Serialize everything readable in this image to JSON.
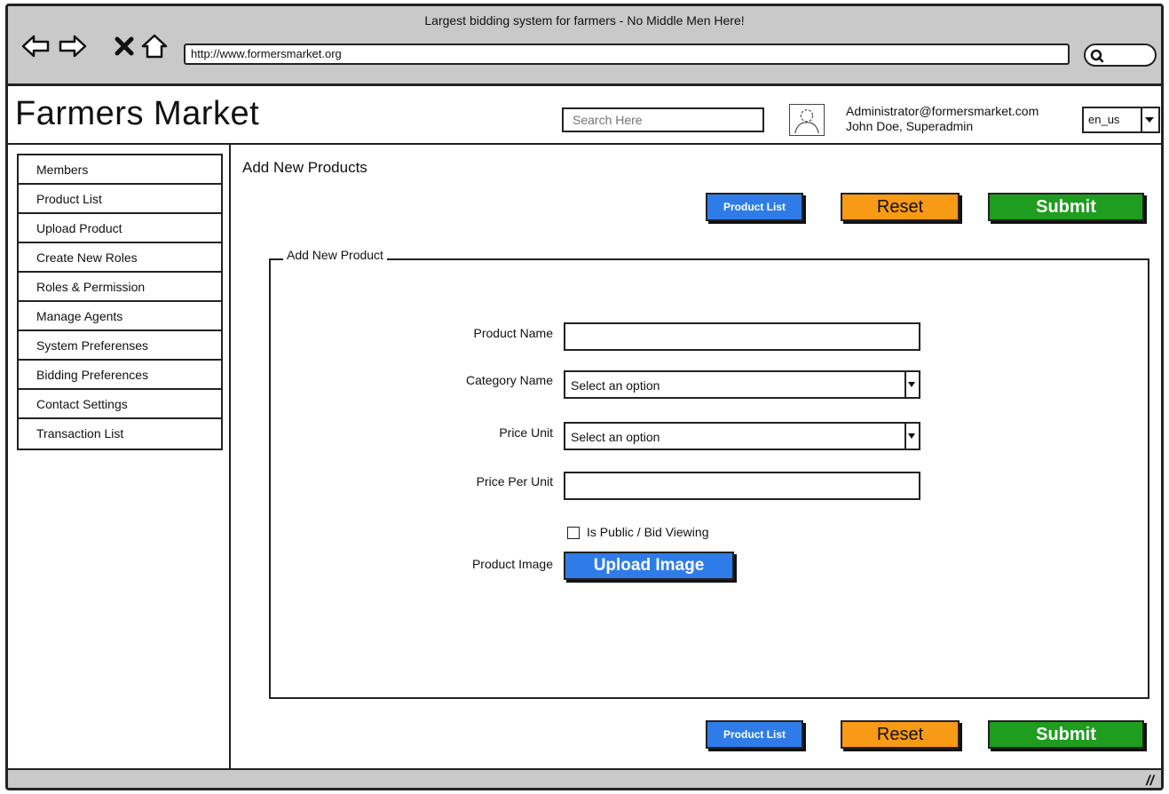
{
  "window": {
    "title": "Largest bidding system for farmers - No Middle Men Here!",
    "url": "http://www.formersmarket.org"
  },
  "header": {
    "app_title": "Farmers Market",
    "search_placeholder": "Search Here",
    "user_email": "Administrator@formersmarket.com",
    "user_name": "John Doe, Superadmin",
    "language": "en_us"
  },
  "sidebar": {
    "items": [
      {
        "label": "Members"
      },
      {
        "label": "Product List"
      },
      {
        "label": "Upload Product"
      },
      {
        "label": "Create New Roles"
      },
      {
        "label": "Roles & Permission"
      },
      {
        "label": "Manage Agents"
      },
      {
        "label": "System Preferenses"
      },
      {
        "label": "Bidding Preferences"
      },
      {
        "label": "Contact Settings"
      },
      {
        "label": "Transaction List"
      }
    ]
  },
  "main": {
    "page_title": "Add New Products",
    "actions": {
      "product_list": "Product List",
      "reset": "Reset",
      "submit": "Submit"
    },
    "form": {
      "legend": "Add New Product",
      "product_name_label": "Product Name",
      "product_name_value": "",
      "category_label": "Category Name",
      "category_value": "Select an option",
      "price_unit_label": "Price Unit",
      "price_unit_value": "Select an option",
      "price_per_unit_label": "Price Per Unit",
      "price_per_unit_value": "",
      "public_label": "Is Public / Bid Viewing",
      "product_image_label": "Product Image",
      "upload_button": "Upload Image"
    }
  },
  "colors": {
    "blue": "#2f7ce8",
    "orange": "#f79a16",
    "green": "#1e9d1e",
    "chrome": "#c9c9c9"
  },
  "icons": [
    "back-arrow-icon",
    "forward-arrow-icon",
    "stop-icon",
    "home-icon",
    "search-icon",
    "avatar-icon",
    "chevron-down-icon",
    "resize-grip-icon"
  ]
}
